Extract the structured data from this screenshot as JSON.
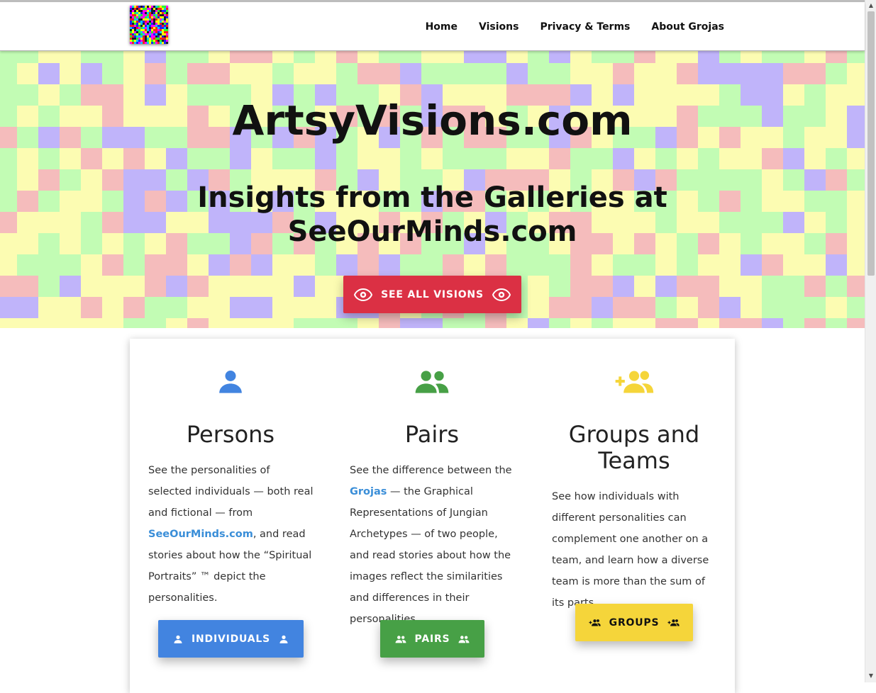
{
  "nav": {
    "items": [
      "Home",
      "Visions",
      "Privacy & Terms",
      "About Grojas"
    ]
  },
  "hero": {
    "title": "ArtsyVisions.com",
    "subtitle_line1": "Insights from the Galleries at",
    "subtitle_line2": "SeeOurMinds.com",
    "button_label": "SEE ALL VISIONS",
    "button_color": "#db3044"
  },
  "columns": [
    {
      "title": "Persons",
      "text_before": "See the personalities of selected individuals — both real and fictional — from ",
      "link": "SeeOurMinds.com",
      "text_after": ", and read stories about how the “Spiritual Portraits” ™ depict the personalities.",
      "button_label": "INDIVIDUALS",
      "color": "#4284e0",
      "icon": "person-icon"
    },
    {
      "title": "Pairs",
      "text_before": "See the difference between the ",
      "link": "Grojas",
      "text_after": " — the Graphical Representations of Jungian Archetypes — of two people, and read stories about how the images reflect the similarities and differences in their personalities.",
      "button_label": "PAIRS",
      "color": "#47a046",
      "icon": "people-icon"
    },
    {
      "title_line1": "Groups and",
      "title_line2": "Teams",
      "text": "See how individuals with different personalities can complement one another on a team, and learn how a diverse team is more than the sum of its parts.",
      "button_label": "GROUPS",
      "color": "#f5d53a",
      "icon": "group-add-icon"
    }
  ]
}
